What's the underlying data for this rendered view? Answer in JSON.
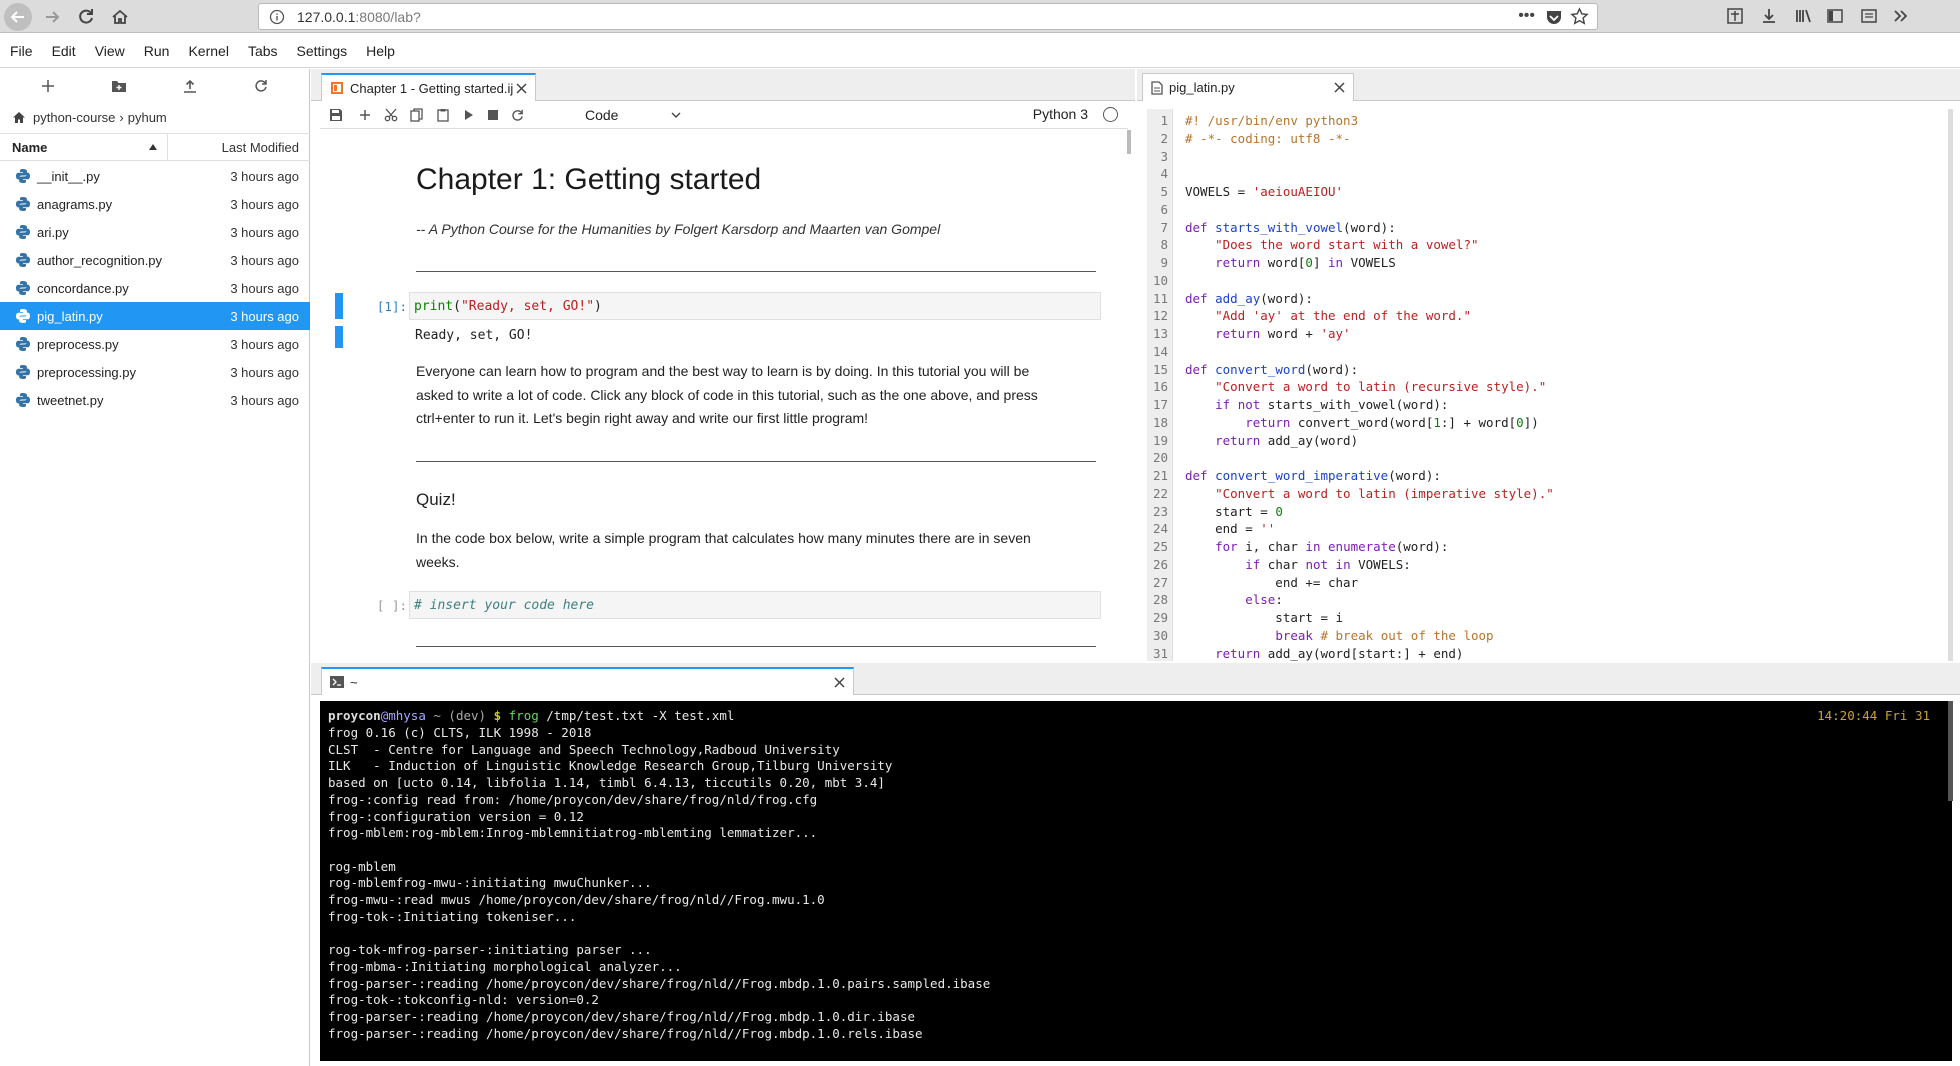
{
  "browser": {
    "url_host": "127.0.0.1",
    "url_rest": ":8080/lab?"
  },
  "menu": [
    "File",
    "Edit",
    "View",
    "Run",
    "Kernel",
    "Tabs",
    "Settings",
    "Help"
  ],
  "filebrowser": {
    "breadcrumb": [
      "python-course",
      "pyhum"
    ],
    "col_name": "Name",
    "col_modified": "Last Modified",
    "files": [
      {
        "name": "__init__.py",
        "modified": "3 hours ago"
      },
      {
        "name": "anagrams.py",
        "modified": "3 hours ago"
      },
      {
        "name": "ari.py",
        "modified": "3 hours ago"
      },
      {
        "name": "author_recognition.py",
        "modified": "3 hours ago"
      },
      {
        "name": "concordance.py",
        "modified": "3 hours ago"
      },
      {
        "name": "pig_latin.py",
        "modified": "3 hours ago",
        "selected": true
      },
      {
        "name": "preprocess.py",
        "modified": "3 hours ago"
      },
      {
        "name": "preprocessing.py",
        "modified": "3 hours ago"
      },
      {
        "name": "tweetnet.py",
        "modified": "3 hours ago"
      }
    ]
  },
  "notebook": {
    "tab_title": "Chapter 1 - Getting started.ij",
    "cell_type": "Code",
    "kernel": "Python 3",
    "title": "Chapter 1: Getting started",
    "subtitle": "-- A Python Course for the Humanities by Folgert Karsdorp and Maarten van Gompel",
    "cell1_prompt": "[1]:",
    "cell1_code_fn": "print",
    "cell1_code_str": "\"Ready, set, GO!\"",
    "cell1_output": "Ready, set, GO!",
    "para1_lines": [
      "Everyone can learn how to program and the best way to learn is by doing. In this tutorial you will be",
      "asked to write a lot of code. Click any block of code in this tutorial, such as the one above, and press",
      "ctrl+enter to run it. Let's begin right away and write our first little program!"
    ],
    "quiz_heading": "Quiz!",
    "para2_lines": [
      "In the code box below, write a simple program that calculates how many minutes there are in seven",
      "weeks."
    ],
    "cell2_prompt": "[ ]:",
    "cell2_code": "# insert your code here"
  },
  "editor": {
    "tab_title": "pig_latin.py",
    "lines": [
      "#! /usr/bin/env python3",
      "# -*- coding: utf8 -*-",
      "",
      "",
      "VOWELS = 'aeiouAEIOU'",
      "",
      "def starts_with_vowel(word):",
      "    \"Does the word start with a vowel?\"",
      "    return word[0] in VOWELS",
      "",
      "def add_ay(word):",
      "    \"Add 'ay' at the end of the word.\"",
      "    return word + 'ay'",
      "",
      "def convert_word(word):",
      "    \"Convert a word to latin (recursive style).\"",
      "    if not starts_with_vowel(word):",
      "        return convert_word(word[1:] + word[0])",
      "    return add_ay(word)",
      "",
      "def convert_word_imperative(word):",
      "    \"Convert a word to latin (imperative style).\"",
      "    start = 0",
      "    end = ''",
      "    for i, char in enumerate(word):",
      "        if char not in VOWELS:",
      "            end += char",
      "        else:",
      "            start = i",
      "            break # break out of the loop",
      "    return add_ay(word[start:] + end)"
    ]
  },
  "terminal": {
    "tab_title": "~",
    "prompt_user": "proycon",
    "prompt_host": "@mhysa",
    "prompt_path": " ~ ",
    "prompt_env": "(dev) ",
    "prompt_symbol": "$ ",
    "command_prog": "frog",
    "command_args": " /tmp/test.txt -X test.xml",
    "clock": "14:20:44 Fri 31",
    "output": [
      "frog 0.16 (c) CLTS, ILK 1998 - 2018",
      "CLST  - Centre for Language and Speech Technology,Radboud University",
      "ILK   - Induction of Linguistic Knowledge Research Group,Tilburg University",
      "based on [ucto 0.14, libfolia 1.14, timbl 6.4.13, ticcutils 0.20, mbt 3.4]",
      "frog-:config read from: /home/proycon/dev/share/frog/nld/frog.cfg",
      "frog-:configuration version = 0.12",
      "frog-mblem:rog-mblem:Inrog-mblemnitiatrog-mblemting lemmatizer...",
      "",
      "rog-mblem",
      "rog-mblemfrog-mwu-:initiating mwuChunker...",
      "frog-mwu-:read mwus /home/proycon/dev/share/frog/nld//Frog.mwu.1.0",
      "frog-tok-:Initiating tokeniser...",
      "",
      "rog-tok-mfrog-parser-:initiating parser ...",
      "frog-mbma-:Initiating morphological analyzer...",
      "frog-parser-:reading /home/proycon/dev/share/frog/nld//Frog.mbdp.1.0.pairs.sampled.ibase",
      "frog-tok-:tokconfig-nld: version=0.2",
      "frog-parser-:reading /home/proycon/dev/share/frog/nld//Frog.mbdp.1.0.dir.ibase",
      "frog-parser-:reading /home/proycon/dev/share/frog/nld//Frog.mbdp.1.0.rels.ibase"
    ]
  }
}
